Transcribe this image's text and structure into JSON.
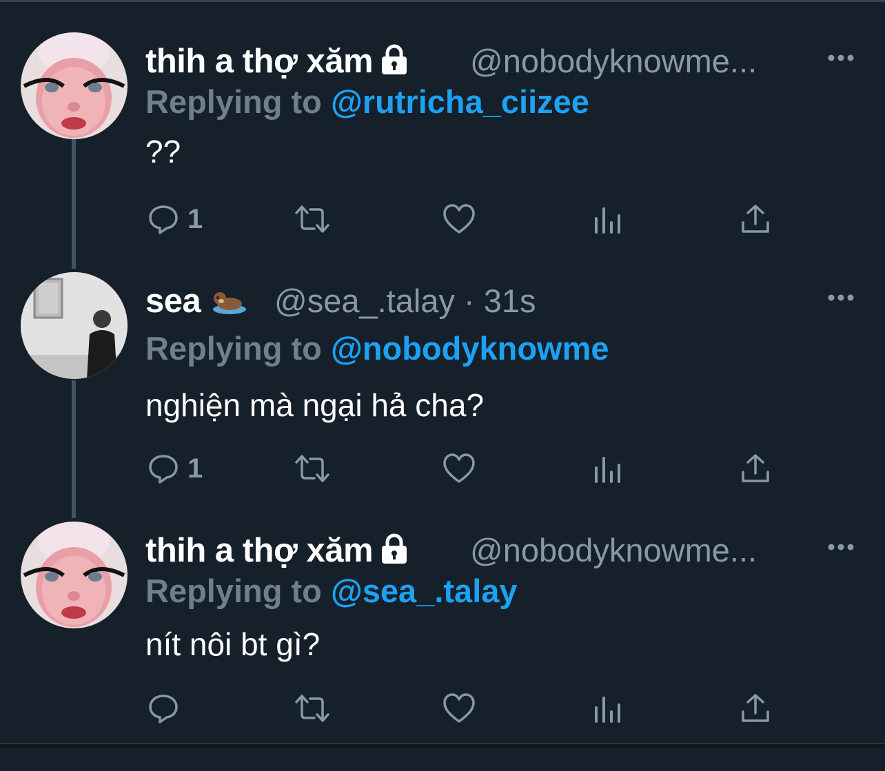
{
  "tweets": [
    {
      "name": "thih a thợ xăm",
      "handle": "@nobodyknowme...",
      "replying_prefix": "Replying to",
      "replying_to": "@rutricha_ciizee",
      "text": "??",
      "reply_count": "1",
      "avatar": "baby-doll",
      "badge_icon": "lock-icon"
    },
    {
      "name": "sea",
      "handle": "@sea_.talay · 31s",
      "replying_prefix": "Replying to",
      "replying_to": "@nobodyknowme",
      "text": "nghiện mà ngại hả cha?",
      "reply_count": "1",
      "avatar": "man-in-gallery",
      "badge_icon": "otter-emoji"
    },
    {
      "name": "thih a thợ xăm",
      "handle": "@nobodyknowme...",
      "replying_prefix": "Replying to",
      "replying_to": "@sea_.talay",
      "text": "nít nôi bt gì?",
      "reply_count": "",
      "avatar": "baby-doll",
      "badge_icon": "lock-icon"
    }
  ],
  "action_icons": [
    "reply-icon",
    "retweet-icon",
    "like-icon",
    "analytics-icon",
    "share-icon",
    "more-icon"
  ],
  "colors": {
    "background": "#15202b",
    "link": "#1da1f2",
    "muted": "#8899a6",
    "thread_line": "#3d5466"
  }
}
